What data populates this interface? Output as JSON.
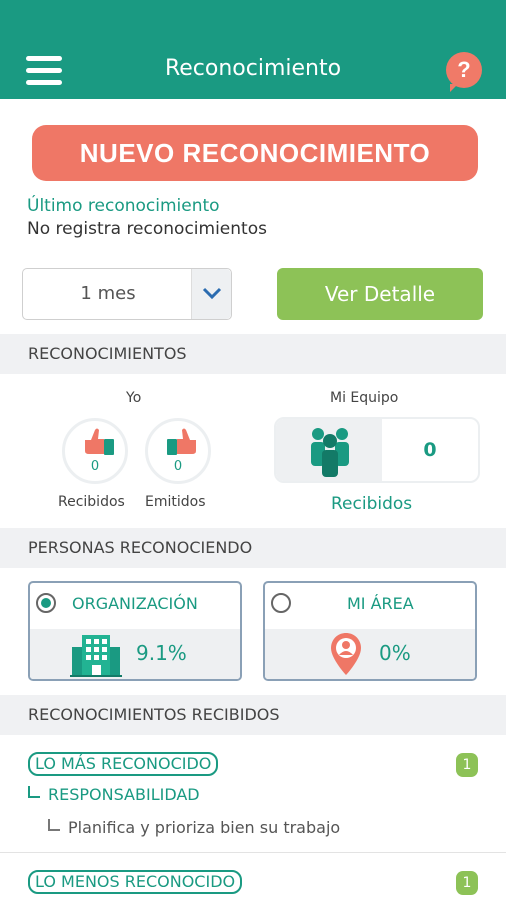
{
  "header": {
    "title": "Reconocimiento",
    "help_label": "?"
  },
  "primary_action": {
    "label": "NUEVO RECONOCIMIENTO"
  },
  "last_recognition": {
    "label": "Último reconocimiento",
    "value": "No registra reconocimientos"
  },
  "filter": {
    "period_value": "1 mes",
    "detail_button": "Ver Detalle"
  },
  "recognitions": {
    "section_title": "RECONOCIMIENTOS",
    "yo_label": "Yo",
    "team_label": "Mi Equipo",
    "received_label": "Recibidos",
    "received_count": "0",
    "emitted_label": "Emitidos",
    "emitted_count": "0",
    "team_count": "0",
    "team_received_label": "Recibidos"
  },
  "people": {
    "section_title": "PERSONAS RECONOCIENDO",
    "organization": {
      "label": "ORGANIZACIÓN",
      "value": "9.1%",
      "selected": true
    },
    "area": {
      "label": "MI ÁREA",
      "value": "0%",
      "selected": false
    }
  },
  "received": {
    "section_title": "RECONOCIMIENTOS RECIBIDOS",
    "most": {
      "label": "LO MÁS RECONOCIDO",
      "count": "1",
      "category": "RESPONSABILIDAD",
      "item": "Planifica y prioriza bien su trabajo"
    },
    "least": {
      "label": "LO MENOS RECONOCIDO",
      "count": "1"
    }
  },
  "colors": {
    "primary": "#1a9a82",
    "accent": "#ef7766",
    "success": "#8dc257"
  }
}
